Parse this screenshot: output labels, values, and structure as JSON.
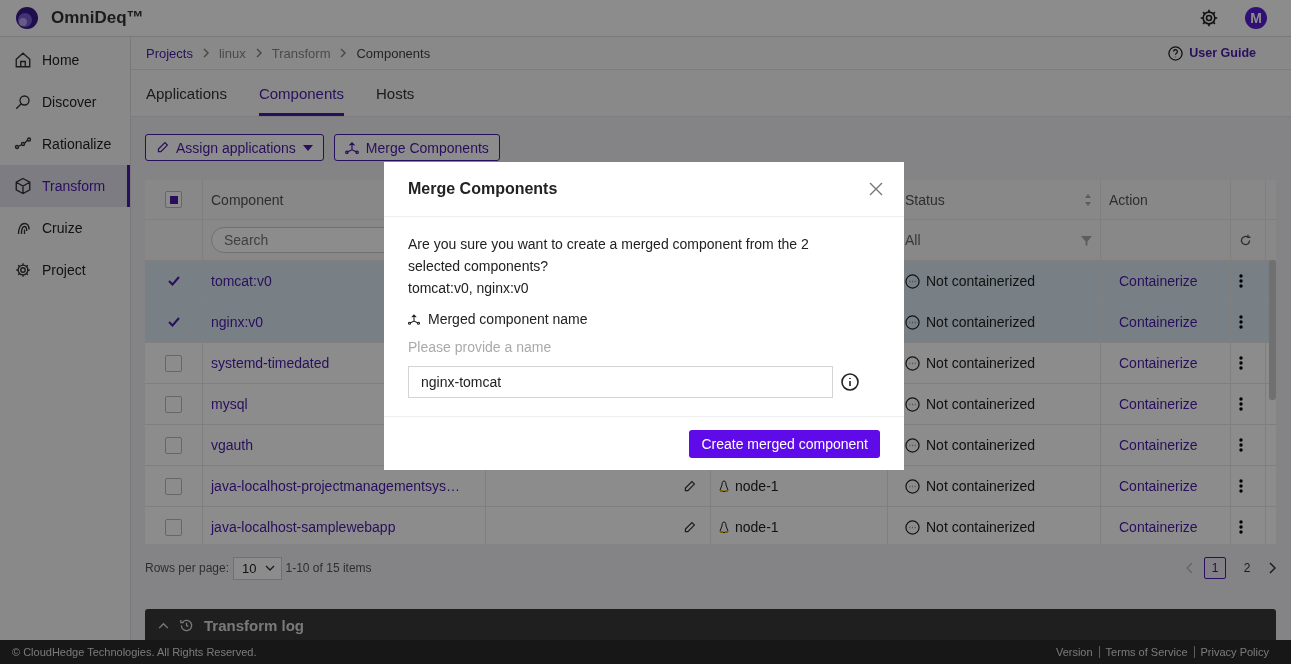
{
  "app": {
    "name": "OmniDeq™",
    "avatar": "M"
  },
  "sidebar": {
    "items": [
      {
        "label": "Home",
        "selected": false
      },
      {
        "label": "Discover",
        "selected": false
      },
      {
        "label": "Rationalize",
        "selected": false
      },
      {
        "label": "Transform",
        "selected": true
      },
      {
        "label": "Cruize",
        "selected": false
      },
      {
        "label": "Project",
        "selected": false
      }
    ]
  },
  "breadcrumb": [
    {
      "label": "Projects",
      "kind": "link"
    },
    {
      "label": "linux",
      "kind": "text"
    },
    {
      "label": "Transform",
      "kind": "text"
    },
    {
      "label": "Components",
      "kind": "current"
    }
  ],
  "help_link": "User Guide",
  "tabs": [
    {
      "label": "Applications",
      "selected": false
    },
    {
      "label": "Components",
      "selected": true
    },
    {
      "label": "Hosts",
      "selected": false
    }
  ],
  "toolbar": {
    "assign": "Assign applications",
    "merge": "Merge Components"
  },
  "table": {
    "columns": [
      "Component",
      "Status",
      "Action"
    ],
    "search_placeholder": "Search",
    "status_filter": "All",
    "select_all_indeterminate": true,
    "rows": [
      {
        "component": "tomcat:v0",
        "selected": true,
        "status": "Not containerized",
        "action": "Containerize"
      },
      {
        "component": "nginx:v0",
        "selected": true,
        "status": "Not containerized",
        "action": "Containerize"
      },
      {
        "component": "systemd-timedated",
        "selected": false,
        "status": "Not containerized",
        "action": "Containerize"
      },
      {
        "component": "mysql",
        "selected": false,
        "status": "Not containerized",
        "action": "Containerize"
      },
      {
        "component": "vgauth",
        "selected": false,
        "status": "Not containerized",
        "action": "Containerize"
      },
      {
        "component": "java-localhost-projectmanagementsys…",
        "selected": false,
        "host": "node-1",
        "status": "Not containerized",
        "action": "Containerize"
      },
      {
        "component": "java-localhost-samplewebapp",
        "selected": false,
        "host": "node-1",
        "status": "Not containerized",
        "action": "Containerize"
      }
    ]
  },
  "pagination": {
    "rows_per_page_label": "Rows per page:",
    "rows_per_page": "10",
    "range": "1-10 of 15 items",
    "pages": [
      {
        "label": "1",
        "selected": true
      },
      {
        "label": "2",
        "selected": false
      }
    ]
  },
  "log_panel": {
    "title": "Transform log"
  },
  "footer": {
    "copyright": "© CloudHedge Technologies. All Rights Reserved.",
    "links": [
      "Version",
      "Terms of Service",
      "Privacy Policy"
    ]
  },
  "dialog": {
    "title": "Merge Components",
    "message": "Are you sure you want to create a merged component from the 2 selected components?",
    "selection": "tomcat:v0, nginx:v0",
    "field_label": "Merged component name",
    "hint": "Please provide a name",
    "value": "nginx-tomcat",
    "submit": "Create merged component"
  }
}
